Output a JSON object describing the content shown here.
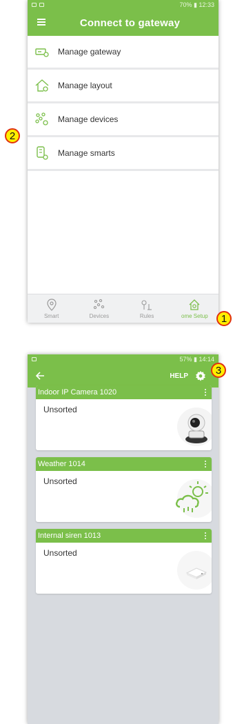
{
  "screen1": {
    "status_bar": {
      "battery": "70%",
      "time": "12:33"
    },
    "title": "Connect to gateway",
    "menu": [
      {
        "label": "Manage gateway",
        "icon": "gateway-icon"
      },
      {
        "label": "Manage layout",
        "icon": "house-layout-icon"
      },
      {
        "label": "Manage devices",
        "icon": "devices-icon"
      },
      {
        "label": "Manage smarts",
        "icon": "smarts-icon"
      }
    ],
    "bottom_nav": [
      {
        "label": "Smart",
        "icon": "location-pin-icon",
        "active": false
      },
      {
        "label": "Devices",
        "icon": "devices-icon",
        "active": false
      },
      {
        "label": "Rules",
        "icon": "rules-icon",
        "active": false
      },
      {
        "label": "ome Setup",
        "icon": "home-gear-icon",
        "active": true
      }
    ]
  },
  "screen2": {
    "status_bar": {
      "battery": "57%",
      "time": "14:14"
    },
    "help": "HELP",
    "devices": [
      {
        "name": "Indoor IP Camera 1020",
        "room": "Unsorted",
        "icon": "ip-camera-icon"
      },
      {
        "name": "Weather 1014",
        "room": "Unsorted",
        "icon": "weather-cloud-sun-icon"
      },
      {
        "name": "Internal siren 1013",
        "room": "Unsorted",
        "icon": "siren-device-icon"
      }
    ]
  },
  "callouts": [
    "1",
    "2",
    "3"
  ],
  "colors": {
    "accent": "#7bbf4a",
    "callout_fill": "#ffee00",
    "callout_border": "#e03010"
  }
}
